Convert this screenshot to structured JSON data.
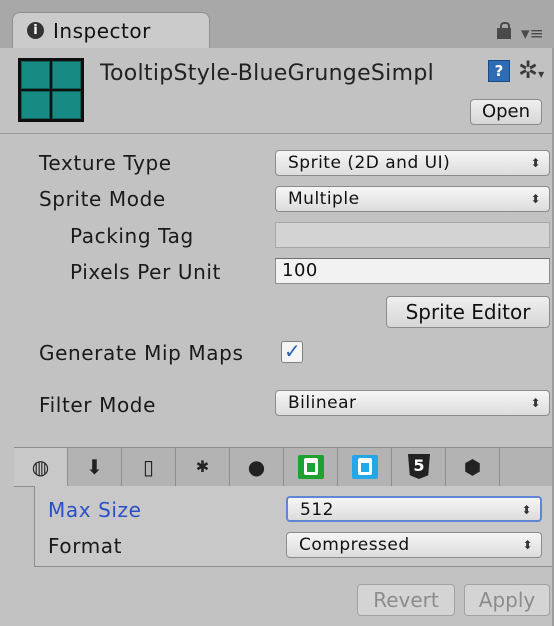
{
  "tab": {
    "label": "Inspector",
    "info_icon": "i"
  },
  "header": {
    "asset_name": "TooltipStyle-BlueGrungeSimpl",
    "help_icon": "?",
    "gear_icon": "✲",
    "open_label": "Open"
  },
  "settings": {
    "texture_type_label": "Texture Type",
    "texture_type_value": "Sprite (2D and UI)",
    "sprite_mode_label": "Sprite Mode",
    "sprite_mode_value": "Multiple",
    "packing_tag_label": "Packing Tag",
    "packing_tag_value": "",
    "pixels_per_unit_label": "Pixels Per Unit",
    "pixels_per_unit_value": "100",
    "sprite_editor_label": "Sprite Editor",
    "generate_mip_maps_label": "Generate Mip Maps",
    "generate_mip_maps_checked": true,
    "filter_mode_label": "Filter Mode",
    "filter_mode_value": "Bilinear"
  },
  "platforms": [
    {
      "name": "default",
      "icon": "globe-icon",
      "glyph": "◍"
    },
    {
      "name": "standalone",
      "icon": "download-icon",
      "glyph": "⬇"
    },
    {
      "name": "ios",
      "icon": "phone-icon",
      "glyph": "▯"
    },
    {
      "name": "android",
      "icon": "android-icon",
      "glyph": "✱"
    },
    {
      "name": "blackberry",
      "icon": "blackberry-icon",
      "glyph": "●"
    },
    {
      "name": "windows-store",
      "icon": "store-green-icon",
      "glyph": "◘",
      "color": "#1da22f"
    },
    {
      "name": "windows-phone",
      "icon": "store-blue-icon",
      "glyph": "◘",
      "color": "#22a8e6"
    },
    {
      "name": "webgl",
      "icon": "html5-icon",
      "glyph": "5"
    },
    {
      "name": "samsung-tv",
      "icon": "cube-icon",
      "glyph": "⬢"
    }
  ],
  "platform_settings": {
    "max_size_label": "Max Size",
    "max_size_value": "512",
    "format_label": "Format",
    "format_value": "Compressed"
  },
  "footer": {
    "revert_label": "Revert",
    "apply_label": "Apply"
  },
  "colors": {
    "accent": "#2b62b0",
    "label_highlight": "#2a50c8",
    "thumb_teal": "#178a84"
  }
}
